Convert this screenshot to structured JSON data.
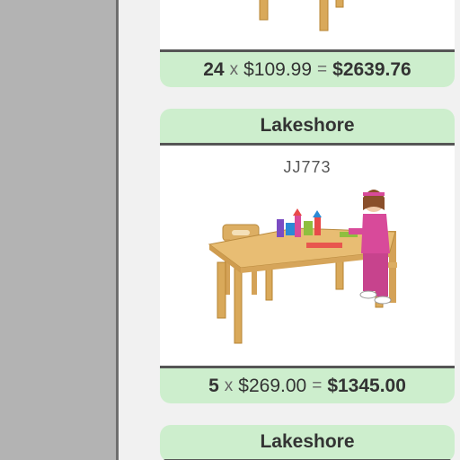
{
  "cards": [
    {
      "brand": "",
      "sku": "",
      "quantity": "24",
      "times": "x",
      "unit_price": "$109.99",
      "equals": "=",
      "total": "$2639.76"
    },
    {
      "brand": "Lakeshore",
      "sku": "JJ773",
      "quantity": "5",
      "times": "x",
      "unit_price": "$269.00",
      "equals": "=",
      "total": "$1345.00"
    },
    {
      "brand": "Lakeshore"
    }
  ],
  "colors": {
    "left_pane": "#b3b3b3",
    "right_pane": "#f1f1f1",
    "card_band": "#cdeecd",
    "band_border": "#555555"
  }
}
